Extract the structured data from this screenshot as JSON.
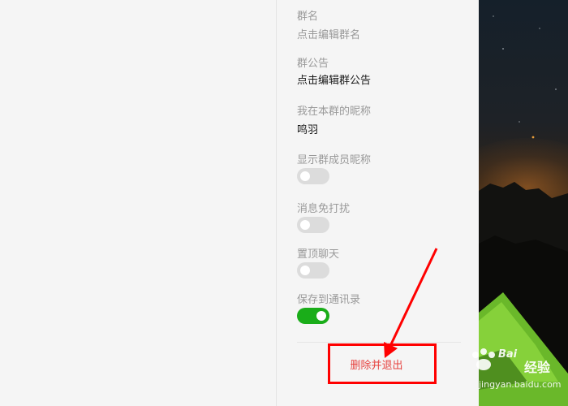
{
  "settings": {
    "group_name": {
      "label": "群名",
      "value": "点击编辑群名"
    },
    "announcement": {
      "label": "群公告",
      "value": "点击编辑群公告"
    },
    "nickname": {
      "label": "我在本群的昵称",
      "value": "鸣羽"
    },
    "show_member_nickname": {
      "label": "显示群成员昵称",
      "enabled": false
    },
    "mute_notifications": {
      "label": "消息免打扰",
      "enabled": false
    },
    "sticky_on_top": {
      "label": "置顶聊天",
      "enabled": false
    },
    "save_to_contacts": {
      "label": "保存到通讯录",
      "enabled": true
    },
    "delete_and_exit_label": "删除并退出"
  },
  "colors": {
    "toggle_on": "#1aad19",
    "toggle_off": "#dcdcdc",
    "danger": "#e64340",
    "annotation": "#ff0000"
  },
  "watermark": {
    "brand": "Bai",
    "title": "经验",
    "url": "jingyan.baidu.com"
  }
}
